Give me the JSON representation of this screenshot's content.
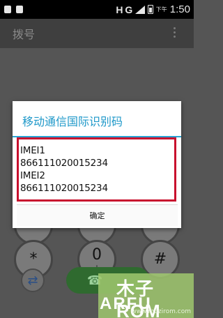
{
  "status_bar": {
    "network": "H G",
    "ampm": "下午",
    "time": "1:50"
  },
  "action_bar": {
    "title": "拨号"
  },
  "dial_pad": {
    "rows": [
      [
        {
          "main": "",
          "sub": ""
        },
        {
          "main": "",
          "sub": ""
        },
        {
          "main": "",
          "sub": ""
        }
      ],
      [
        {
          "main": "*",
          "sub": ""
        },
        {
          "main": "0",
          "sub": "+"
        },
        {
          "main": "#",
          "sub": ""
        }
      ]
    ]
  },
  "dialog": {
    "title": "移动通信国际识别码",
    "lines": [
      "IMEI1",
      "866111020015234",
      "IMEI2",
      "866111020015234"
    ],
    "ok_label": "确定"
  },
  "watermark": {
    "top": "木子ROM",
    "bottom": "ARFU",
    "small": "www.muzirom.com"
  },
  "colors": {
    "dialog_title": "#1e98c9",
    "divider": "#29a3d4",
    "highlight_border": "#c8102e",
    "call_button": "#2f6a2f"
  }
}
